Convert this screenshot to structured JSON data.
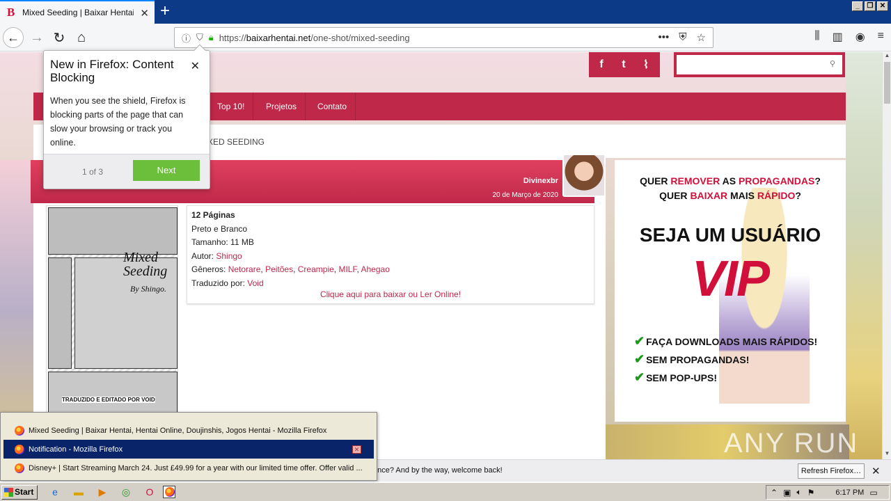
{
  "browser": {
    "tab_title": "Mixed Seeding | Baixar Hentai, Hen",
    "url_prefix": "https://",
    "url_host": "baixarhentai.net",
    "url_path": "/one-shot/mixed-seeding"
  },
  "site": {
    "menu": [
      "Top 10!",
      "Projetos",
      "Contato"
    ],
    "breadcrumb": "XED SEEDING",
    "author": "Divinexbr",
    "date": "20 de Março de 2020",
    "cover_title": "Mixed Seeding",
    "cover_by": "By Shingo.",
    "cover_credit": "TRADUZIDO E EDITADO POR VOID",
    "info": {
      "pages": "12 Páginas",
      "color": "Preto e Branco",
      "size_label": "Tamanho:",
      "size_value": "11 MB",
      "author_label": "Autor:",
      "author_value": "Shingo",
      "genres_label": "Gêneros:",
      "genres": [
        "Netorare",
        "Peitões",
        "Creampie",
        "MILF",
        "Ahegao"
      ],
      "translator_label": "Traduzido por:",
      "translator_value": "Void",
      "download_link": "Clique aqui para baixar ou Ler Online!"
    },
    "ad": {
      "line1_a": "QUER ",
      "line1_b": "REMOVER",
      "line1_c": " AS ",
      "line1_d": "PROPAGANDAS",
      "line1_e": "?",
      "line2_a": "QUER ",
      "line2_b": "BAIXAR",
      "line2_c": " MAIS ",
      "line2_d": "RÁPIDO",
      "line2_e": "?",
      "seja": "SEJA UM USUÁRIO",
      "vip": "VIP",
      "checks": [
        "FAÇA DOWNLOADS MAIS RÁPIDOS!",
        "SEM PROPAGANDAS!",
        "SEM POP-UPS!"
      ]
    }
  },
  "doorhanger": {
    "title": "New in Firefox: Content Blocking",
    "body": "When you see the shield, Firefox is blocking parts of the page that can slow your browsing or track you online.",
    "count": "1 of 3",
    "next": "Next"
  },
  "notification": {
    "text": "ence? And by the way, welcome back!",
    "button": "Refresh Firefox…"
  },
  "taskbar_popup": [
    "Mixed Seeding | Baixar Hentai, Hentai Online, Doujinshis, Jogos Hentai - Mozilla Firefox",
    "Notification - Mozilla Firefox",
    "Disney+ | Start Streaming March 24. Just £49.99 for a year with our limited time offer. Offer valid ..."
  ],
  "taskbar": {
    "start": "Start",
    "clock": "6:17 PM"
  },
  "watermark": "ANY RUN"
}
